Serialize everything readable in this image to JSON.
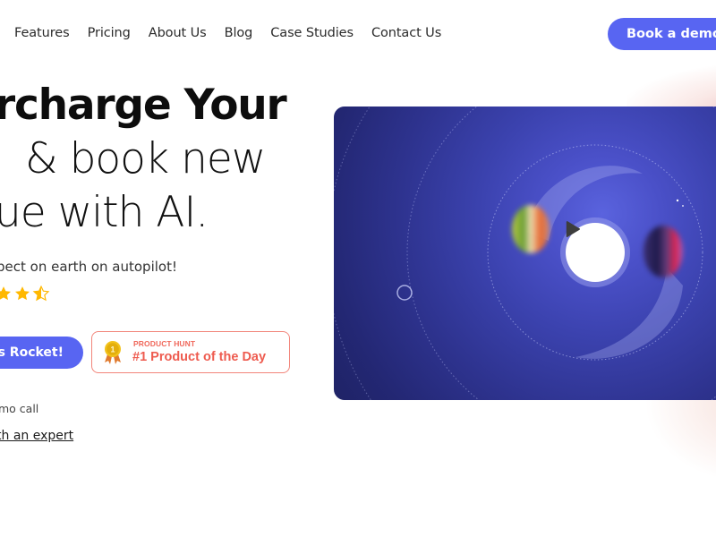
{
  "nav": {
    "links": [
      "Features",
      "Pricing",
      "About Us",
      "Blog",
      "Case Studies",
      "Contact Us"
    ],
    "cta_label": "Book a demo"
  },
  "hero": {
    "headline_line1": "rcharge Your",
    "headline_line2": "& book new",
    "headline_line3": "ue with AI.",
    "subtext": "pect on earth on autopilot!",
    "rating": {
      "value": 3.5,
      "visible_stars": 3,
      "partial_star": "half"
    },
    "primary_cta_label": "t's Rocket!",
    "demo_note": "mo call",
    "expert_link": "th an expert"
  },
  "product_hunt": {
    "eyebrow": "PRODUCT HUNT",
    "title": "#1 Product of the Day",
    "medal_number": "1",
    "icon": "medal-icon"
  },
  "video": {
    "icon": "play-icon"
  },
  "colors": {
    "brand": "#5865f2",
    "star": "#ffb800",
    "product_hunt": "#ee5b4f"
  }
}
